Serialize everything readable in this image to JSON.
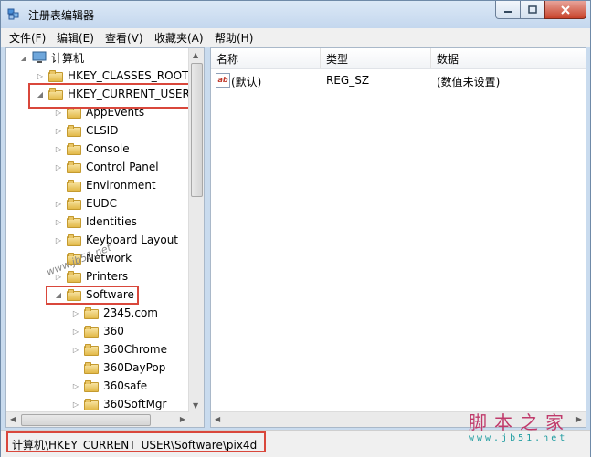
{
  "window": {
    "title": "注册表编辑器"
  },
  "menu": [
    "文件(F)",
    "编辑(E)",
    "查看(V)",
    "收藏夹(A)",
    "帮助(H)"
  ],
  "tree": {
    "root": "计算机",
    "items": [
      {
        "label": "HKEY_CLASSES_ROOT",
        "expander": "▷"
      },
      {
        "label": "HKEY_CURRENT_USER",
        "expander": "◢"
      },
      {
        "label": "AppEvents",
        "expander": "▷"
      },
      {
        "label": "CLSID",
        "expander": "▷"
      },
      {
        "label": "Console",
        "expander": "▷"
      },
      {
        "label": "Control Panel",
        "expander": "▷"
      },
      {
        "label": "Environment",
        "expander": ""
      },
      {
        "label": "EUDC",
        "expander": "▷"
      },
      {
        "label": "Identities",
        "expander": "▷"
      },
      {
        "label": "Keyboard Layout",
        "expander": "▷"
      },
      {
        "label": "Network",
        "expander": ""
      },
      {
        "label": "Printers",
        "expander": "▷"
      },
      {
        "label": "Software",
        "expander": "◢"
      },
      {
        "label": "2345.com",
        "expander": "▷"
      },
      {
        "label": "360",
        "expander": "▷"
      },
      {
        "label": "360Chrome",
        "expander": "▷"
      },
      {
        "label": "360DayPop",
        "expander": ""
      },
      {
        "label": "360safe",
        "expander": "▷"
      },
      {
        "label": "360SoftMgr",
        "expander": "▷"
      }
    ]
  },
  "values_pane": {
    "columns": [
      "名称",
      "类型",
      "数据"
    ],
    "rows": [
      {
        "icon": "ab",
        "name": "(默认)",
        "type": "REG_SZ",
        "data": "(数值未设置)"
      }
    ]
  },
  "status": {
    "path": "计算机\\HKEY_CURRENT_USER\\Software\\pix4d"
  },
  "watermark": {
    "diagonal": "www.jb51.net",
    "logo": "脚本之家",
    "url": "www.jb51.net"
  },
  "colors": {
    "highlight": "#d9473b",
    "folder": "#e2b948"
  }
}
